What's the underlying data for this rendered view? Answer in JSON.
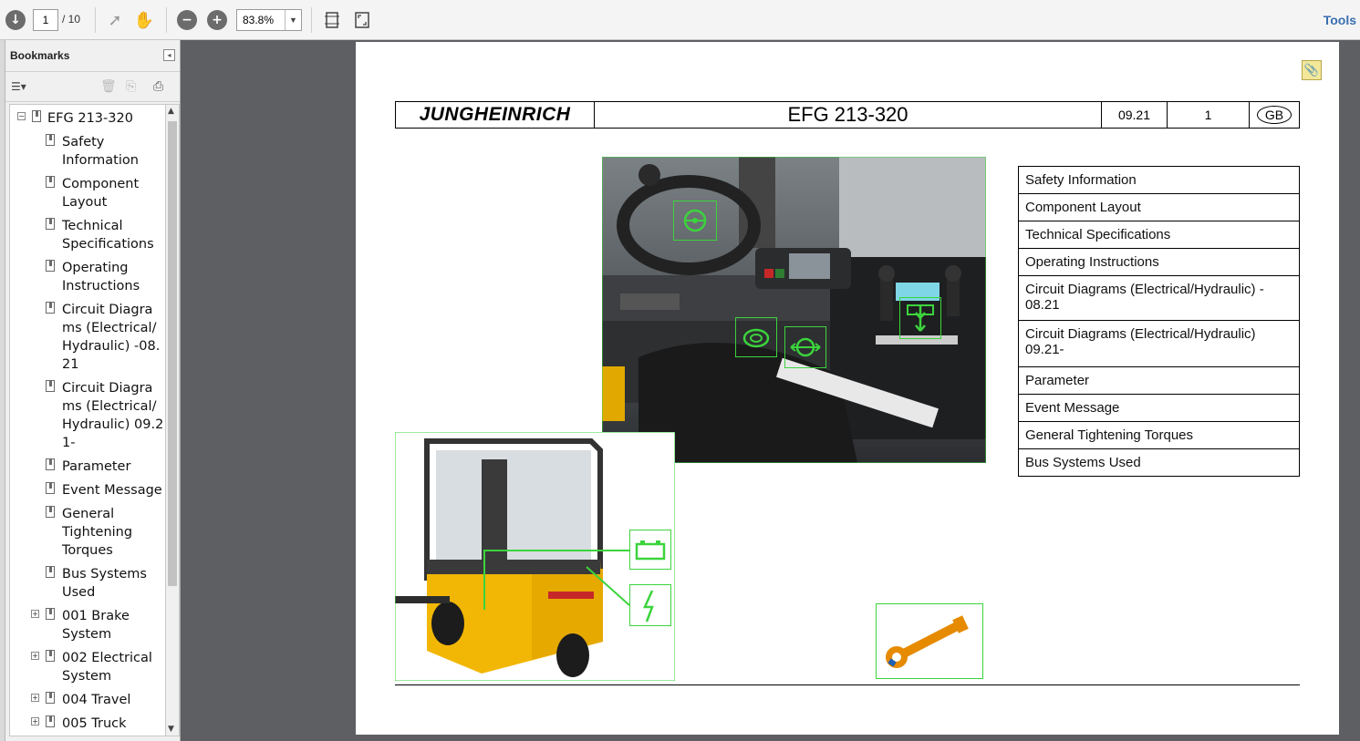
{
  "toolbar": {
    "page_current": "1",
    "page_total": "/ 10",
    "zoom": "83.8%",
    "tools_label": "Tools"
  },
  "bookmarks": {
    "title": "Bookmarks",
    "items": [
      {
        "label": "EFG 213-320"
      },
      {
        "label": "Safety Information"
      },
      {
        "label": "Component Layout"
      },
      {
        "label": "Technical Specifications"
      },
      {
        "label": "Operating Instructions"
      },
      {
        "label": "Circuit Diagrams (Electrical/Hydraulic) -08.21"
      },
      {
        "label": "Circuit Diagrams (Electrical/Hydraulic) 09.21-"
      },
      {
        "label": "Parameter"
      },
      {
        "label": "Event Message"
      },
      {
        "label": "General Tightening Torques"
      },
      {
        "label": "Bus Systems Used"
      },
      {
        "label": "001 Brake System"
      },
      {
        "label": "002 Electrical System"
      },
      {
        "label": "004 Travel"
      },
      {
        "label": "005 Truck"
      }
    ]
  },
  "document": {
    "brand": "JUNGHEINRICH",
    "model": "EFG 213-320",
    "date": "09.21",
    "page": "1",
    "lang": "GB",
    "menu": [
      "Safety Information",
      "Component Layout",
      "Technical Specifications",
      "Operating Instructions",
      "Circuit Diagrams (Electrical/Hydraulic) - 08.21",
      "Circuit Diagrams (Electrical/Hydraulic) 09.21-",
      "Parameter",
      "Event Message",
      "General Tightening Torques",
      "Bus Systems Used"
    ]
  },
  "colors": {
    "hotspot": "#3cd43c",
    "truck_yellow": "#f2b705",
    "toolbar_bg": "#f4f4f4",
    "doc_bg": "#5d5f63"
  }
}
